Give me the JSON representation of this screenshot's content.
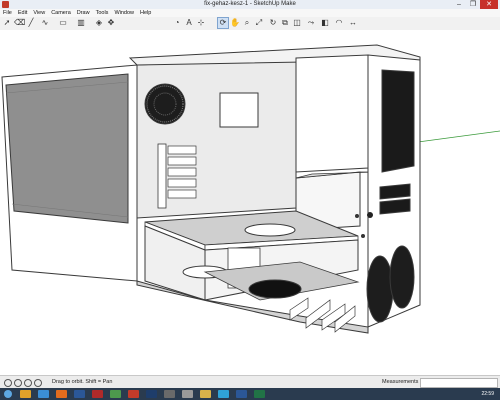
{
  "window": {
    "title": "fix-gehaz-kesz-1 - SketchUp Make"
  },
  "menu": [
    "File",
    "Edit",
    "View",
    "Camera",
    "Draw",
    "Tools",
    "Window",
    "Help"
  ],
  "toolbar": {
    "tools": [
      "select-tool-icon",
      "eraser-tool-icon",
      "line-tool-icon",
      "freehand-tool-icon",
      "rectangle-tool-icon",
      "push-pull-tool-icon",
      "paint-bucket-tool-icon",
      "move-tool-icon",
      "orbit-tool-icon",
      "pan-tool-icon",
      "zoom-tool-icon",
      "zoom-extents-icon",
      "tape-measure-icon",
      "text-tool-icon",
      "axes-tool-icon",
      "dimension-tool-icon",
      "protractor-tool-icon",
      "rotate-tool-icon",
      "scale-tool-icon",
      "offset-tool-icon",
      "follow-me-tool-icon",
      "section-plane-icon"
    ],
    "active_tool": "orbit-tool-icon"
  },
  "status": {
    "hint": "Drag to orbit.  Shift = Pan",
    "measurements_label": "Measurements",
    "measurements_value": ""
  },
  "taskbar": {
    "apps": [
      "explorer",
      "chrome",
      "firefox",
      "word",
      "acrobat",
      "paint",
      "sketchup",
      "photoshop",
      "media",
      "settings",
      "folder",
      "skype",
      "word2",
      "excel"
    ],
    "clock": "22:59"
  },
  "colors": {
    "panel": "#ffffff",
    "panel_shadow": "#e6e6e6",
    "edge": "#3a3a3a",
    "window_glass": "#8f8f8f",
    "floor": "#c9c9c9",
    "axis_green": "#3a9a3a"
  }
}
